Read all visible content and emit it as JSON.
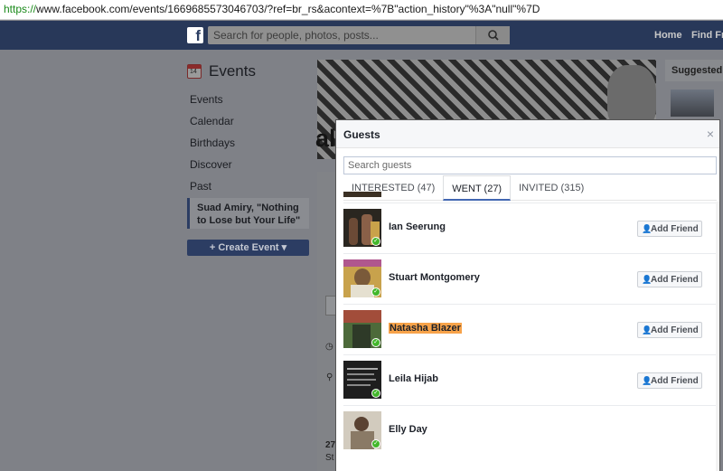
{
  "browser": {
    "url_proto": "https://",
    "url_rest": "www.facebook.com/events/1669685573046703/?ref=br_rs&acontext=%7B\"action_history\"%3A\"null\"%7D"
  },
  "header": {
    "logo": "f",
    "search_placeholder": "Search for people, photos, posts...",
    "nav": [
      "Home",
      "Find Friends"
    ]
  },
  "sidebar": {
    "title": "Events",
    "calendar_day": "14",
    "items": [
      "Events",
      "Calendar",
      "Birthdays",
      "Discover",
      "Past"
    ],
    "active_item": "Suad Amiry, \"Nothing to Lose but Your Life\"",
    "create_button": "+ Create Event ▾"
  },
  "page": {
    "title_fragment": "al",
    "side_header": "Suggested Events",
    "stub_date": "27",
    "stub_text": "St"
  },
  "modal": {
    "title": "Guests",
    "close": "×",
    "search_placeholder": "Search guests",
    "tabs": [
      {
        "label": "INTERESTED (47)",
        "active": false
      },
      {
        "label": "WENT (27)",
        "active": true
      },
      {
        "label": "INVITED (315)",
        "active": false
      }
    ],
    "add_friend_label": "Add Friend",
    "guests": [
      {
        "name": "Ian Seerung",
        "has_add_button": true,
        "highlight": false,
        "avatar_color": "#2a2620"
      },
      {
        "name": "Stuart Montgomery",
        "has_add_button": true,
        "highlight": false,
        "avatar_color": "#b5a060"
      },
      {
        "name": "Natasha Blazer",
        "has_add_button": true,
        "highlight": true,
        "avatar_color": "#4d6a3a"
      },
      {
        "name": "Leila Hijab",
        "has_add_button": true,
        "highlight": false,
        "avatar_color": "#1e1e1e"
      },
      {
        "name": "Elly Day",
        "has_add_button": false,
        "highlight": false,
        "avatar_color": "#c9c2b6"
      }
    ]
  }
}
